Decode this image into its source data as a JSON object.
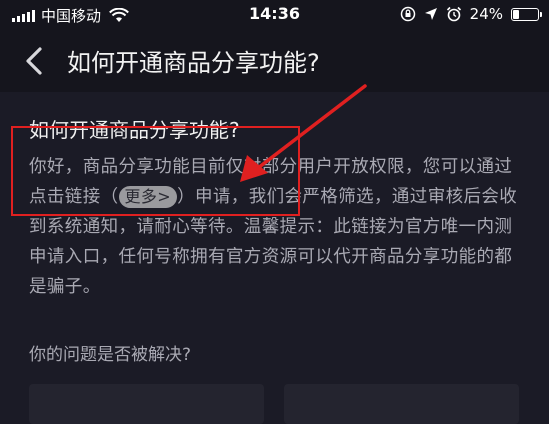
{
  "status_bar": {
    "carrier": "中国移动",
    "time": "14:36",
    "battery_percent": "24%",
    "battery_level": 0.24,
    "icons": [
      "signal-icon",
      "wifi-icon",
      "rotation-lock-icon",
      "location-icon",
      "alarm-icon",
      "battery-icon"
    ]
  },
  "nav": {
    "back_icon": "chevron-left-icon",
    "title": "如何开通商品分享功能?"
  },
  "article": {
    "title": "如何开通商品分享功能?",
    "body_before_link": "你好，商品分享功能目前仅对部分用户开放权限，您可以通过点击链接（",
    "more_link": "更多>",
    "body_after_link": "）申请，我们会严格筛选，通过审核后会收到系统通知，请耐心等待。温馨提示：此链接为官方唯一内测申请入口，任何号称拥有官方资源可以代开商品分享功能的都是骗子。"
  },
  "feedback": {
    "question": "你的问题是否被解决?"
  },
  "colors": {
    "background": "#1b1b26",
    "annotation": "#e02020",
    "body_text": "#a9a9b3"
  }
}
